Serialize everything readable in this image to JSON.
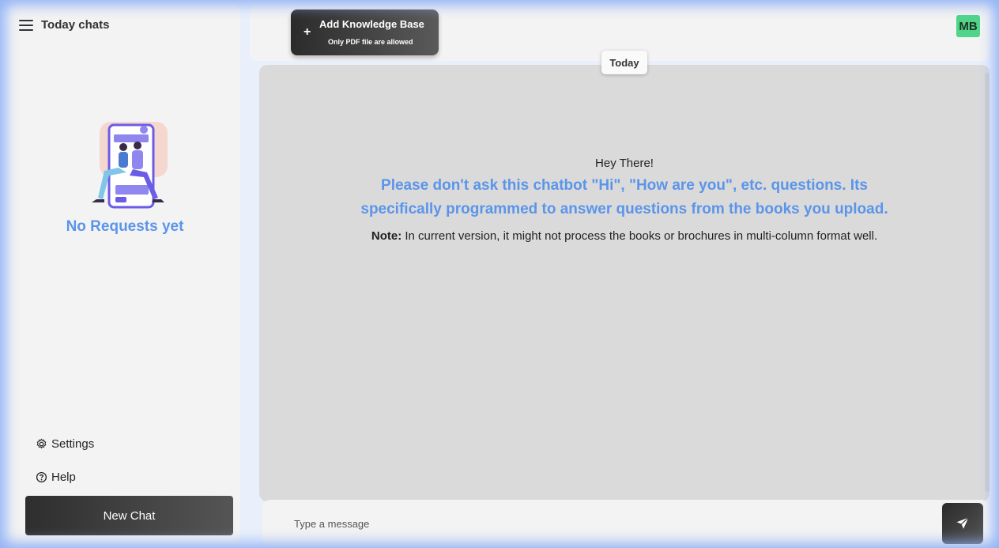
{
  "sidebar": {
    "title": "Today chats",
    "empty_text": "No Requests yet",
    "settings_label": "Settings",
    "help_label": "Help",
    "new_chat_label": "New Chat"
  },
  "header": {
    "kb_button": {
      "title": "Add Knowledge Base",
      "subtitle": "Only PDF file are allowed"
    },
    "avatar_initials": "MB"
  },
  "chat": {
    "date_divider": "Today",
    "greeting": "Hey There!",
    "warning": "Please don't ask this chatbot \"Hi\", \"How are you\", etc. questions. Its specifically programmed to answer questions from the books you upload.",
    "note_label": "Note:",
    "note_text": " In current version, it might not process the books or brochures in multi-column format well."
  },
  "composer": {
    "placeholder": "Type a message"
  },
  "colors": {
    "accent": "#5b95ea",
    "avatar_bg": "#4fd489"
  }
}
